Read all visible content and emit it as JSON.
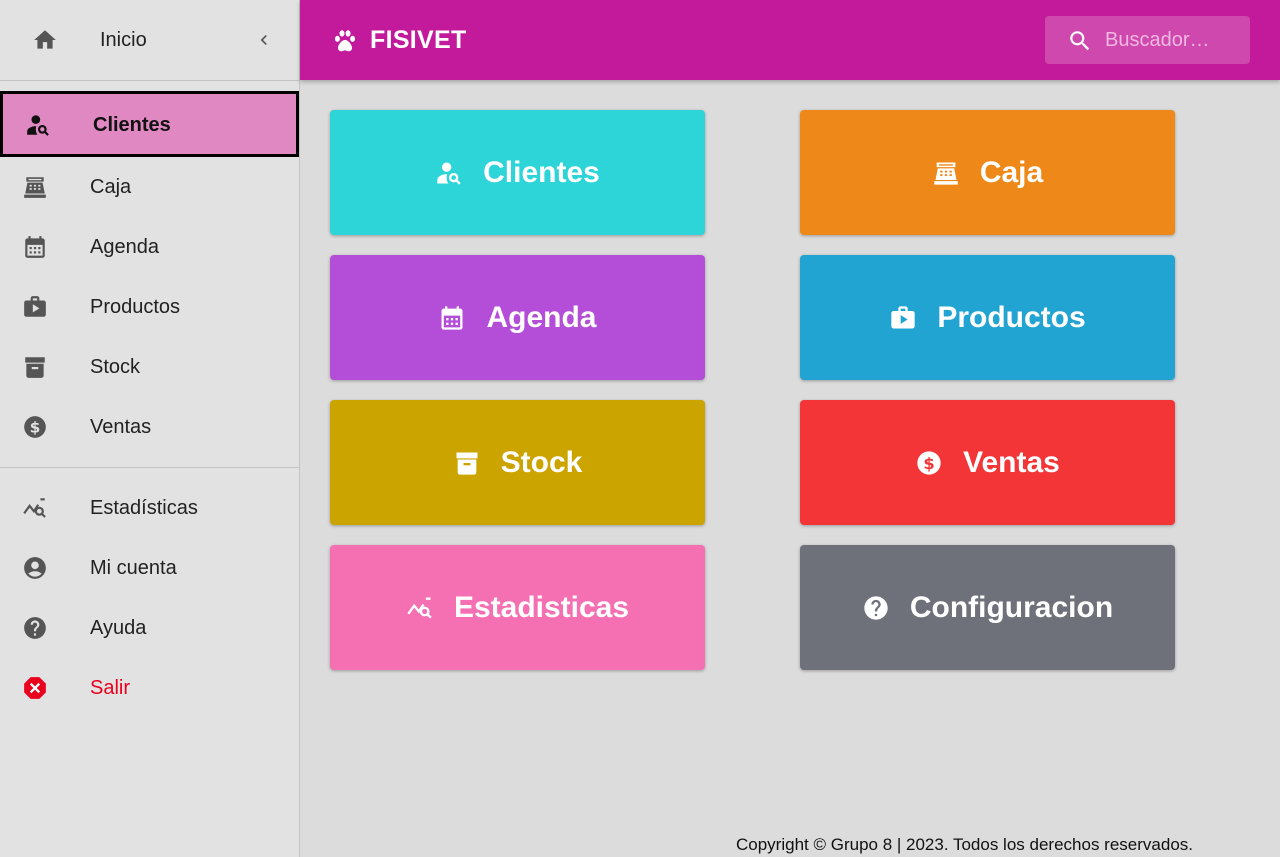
{
  "sidebar": {
    "header": {
      "label": "Inicio",
      "icon": "home-icon",
      "collapse_icon": "chevron-left-icon"
    },
    "items": [
      {
        "label": "Clientes",
        "icon": "person-search-icon",
        "active": true
      },
      {
        "label": "Caja",
        "icon": "cash-register-icon"
      },
      {
        "label": "Agenda",
        "icon": "calendar-icon"
      },
      {
        "label": "Productos",
        "icon": "briefcase-play-icon"
      },
      {
        "label": "Stock",
        "icon": "archive-box-icon"
      },
      {
        "label": "Ventas",
        "icon": "dollar-coin-icon"
      }
    ],
    "secondary": [
      {
        "label": "Estadísticas",
        "icon": "chart-search-icon"
      },
      {
        "label": "Mi cuenta",
        "icon": "account-circle-icon"
      },
      {
        "label": "Ayuda",
        "icon": "help-circle-icon"
      },
      {
        "label": "Salir",
        "icon": "close-circle-icon",
        "color": "#e8001d"
      }
    ]
  },
  "topbar": {
    "brand": "FISIVET",
    "brand_icon": "paw-icon",
    "search_placeholder": "Buscador…",
    "background": "#c21a9b"
  },
  "tiles": [
    {
      "label": "Clientes",
      "icon": "person-search-icon",
      "color": "#2dd4d8"
    },
    {
      "label": "Caja",
      "icon": "cash-register-icon",
      "color": "#ee8818"
    },
    {
      "label": "Agenda",
      "icon": "calendar-icon",
      "color": "#b44ed8"
    },
    {
      "label": "Productos",
      "icon": "briefcase-play-icon",
      "color": "#22a4d2"
    },
    {
      "label": "Stock",
      "icon": "archive-box-icon",
      "color": "#cca400"
    },
    {
      "label": "Ventas",
      "icon": "dollar-coin-icon",
      "color": "#f43538"
    },
    {
      "label": "Estadisticas",
      "icon": "chart-search-icon",
      "color": "#f470b2"
    },
    {
      "label": "Configuracion",
      "icon": "help-circle-icon",
      "color": "#6e707a"
    }
  ],
  "footer": {
    "text": "Copyright © Grupo 8 | 2023. Todos los derechos reservados."
  }
}
